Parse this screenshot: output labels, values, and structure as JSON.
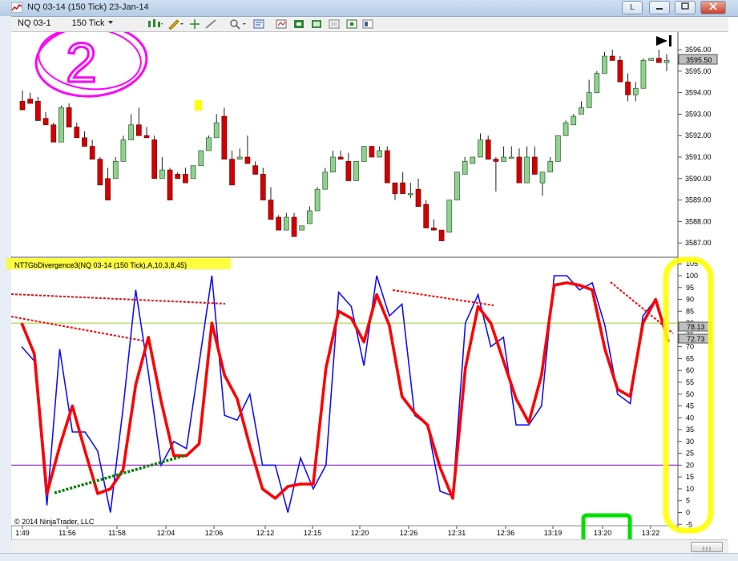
{
  "window": {
    "title": "NQ 03-14 (150 Tick)  23-Jan-14",
    "buttons": [
      "L",
      "",
      ""
    ]
  },
  "toolbar": {
    "instrument_label": "NQ 03-1",
    "period_label": "150 Tick"
  },
  "chart": {
    "indicator_label": "NT7GbDivergence3(NQ 03-14 (150 Tick),A,10,3,8,45)",
    "copyright": "© 2014 NinjaTrader, LLC",
    "price_axis": [
      "3596.00",
      "3595.00",
      "3594.00",
      "3593.00",
      "3592.00",
      "3591.00",
      "3590.00",
      "3589.00",
      "3588.00",
      "3587.00"
    ],
    "price_marker": "3595.50",
    "osc_axis": [
      "105",
      "100",
      "95",
      "90",
      "85",
      "80",
      "75",
      "70",
      "65",
      "60",
      "55",
      "50",
      "45",
      "40",
      "35",
      "30",
      "25",
      "20",
      "15",
      "10",
      "5",
      "0",
      "-5"
    ],
    "osc_markers": [
      "78.13",
      "72.73"
    ],
    "time_axis": [
      "1:49",
      "11:56",
      "11:58",
      "12:04",
      "12:06",
      "12:12",
      "12:15",
      "12:20",
      "12:26",
      "12:31",
      "12:36",
      "13:19",
      "13:20",
      "13:22"
    ],
    "annotation_number": "2",
    "colors": {
      "up_candle": "#8fd18f",
      "down_candle": "#d40000",
      "fast_line": "#1010ff",
      "slow_line": "#ff0000",
      "level_upper": "#9acd32",
      "level_lower": "#9932cc",
      "highlight_yellow": "#ffff00",
      "highlight_green": "#00e000",
      "annotation_magenta": "#ff00ff"
    },
    "levels": {
      "upper": 80,
      "lower": 20
    },
    "candles": [
      [
        3593.6,
        3594.1,
        3593.9,
        3593.2
      ],
      [
        3593.7,
        3594.0,
        3593.7,
        3593.5
      ],
      [
        3593.6,
        3593.8,
        3593.6,
        3592.7
      ],
      [
        3592.8,
        3593.1,
        3592.8,
        3592.5
      ],
      [
        3592.5,
        3592.6,
        3592.5,
        3591.7
      ],
      [
        3591.7,
        3593.4,
        3591.8,
        3593.3
      ],
      [
        3593.3,
        3593.5,
        3593.3,
        3592.4
      ],
      [
        3592.4,
        3592.6,
        3592.4,
        3591.9
      ],
      [
        3591.9,
        3592.2,
        3591.8,
        3591.5
      ],
      [
        3591.5,
        3591.8,
        3591.5,
        3590.9
      ],
      [
        3590.9,
        3591.0,
        3590.9,
        3589.7
      ],
      [
        3590.0,
        3590.5,
        3590.0,
        3589.0
      ],
      [
        3590.0,
        3591.0,
        3590.0,
        3590.8
      ],
      [
        3590.8,
        3592.0,
        3590.8,
        3591.8
      ],
      [
        3591.8,
        3593.0,
        3591.8,
        3592.5
      ],
      [
        3592.5,
        3593.3,
        3592.4,
        3592.0
      ],
      [
        3592.0,
        3592.4,
        3592.0,
        3591.9
      ],
      [
        3591.8,
        3592.0,
        3591.8,
        3590.0
      ],
      [
        3590.0,
        3591.0,
        3590.0,
        3590.4
      ],
      [
        3590.4,
        3590.5,
        3590.2,
        3589.0
      ],
      [
        3590.2,
        3590.3,
        3590.2,
        3590.0
      ],
      [
        3590.2,
        3590.5,
        3590.2,
        3589.8
      ],
      [
        3590.0,
        3590.6,
        3590.0,
        3590.6
      ],
      [
        3590.6,
        3591.3,
        3590.6,
        3591.3
      ],
      [
        3591.3,
        3592.0,
        3591.3,
        3591.9
      ],
      [
        3591.9,
        3593.0,
        3591.9,
        3592.6
      ],
      [
        3592.9,
        3593.3,
        3592.9,
        3590.9
      ],
      [
        3590.9,
        3591.3,
        3590.9,
        3589.7
      ],
      [
        3590.9,
        3591.4,
        3590.9,
        3591.0
      ],
      [
        3591.0,
        3592.0,
        3591.0,
        3590.7
      ],
      [
        3590.6,
        3590.8,
        3590.6,
        3590.2
      ],
      [
        3590.2,
        3590.5,
        3590.2,
        3589.0
      ],
      [
        3589.0,
        3589.6,
        3589.0,
        3588.1
      ],
      [
        3588.2,
        3588.3,
        3588.2,
        3587.6
      ],
      [
        3587.6,
        3588.4,
        3587.6,
        3588.2
      ],
      [
        3588.2,
        3588.4,
        3588.0,
        3587.3
      ],
      [
        3587.6,
        3587.8,
        3587.6,
        3587.8
      ],
      [
        3587.9,
        3588.7,
        3587.9,
        3588.5
      ],
      [
        3588.5,
        3589.6,
        3588.5,
        3589.5
      ],
      [
        3589.5,
        3590.5,
        3589.5,
        3590.3
      ],
      [
        3590.3,
        3591.3,
        3590.3,
        3591.0
      ],
      [
        3591.0,
        3591.3,
        3591.0,
        3590.9
      ],
      [
        3590.8,
        3591.2,
        3590.8,
        3589.9
      ],
      [
        3589.9,
        3590.8,
        3589.9,
        3590.8
      ],
      [
        3590.8,
        3591.5,
        3590.8,
        3591.5
      ],
      [
        3591.5,
        3591.5,
        3591.5,
        3591.0
      ],
      [
        3591.0,
        3591.5,
        3591.0,
        3591.3
      ],
      [
        3591.3,
        3591.5,
        3591.2,
        3589.8
      ],
      [
        3589.8,
        3589.8,
        3589.0,
        3589.3
      ],
      [
        3589.8,
        3590.3,
        3589.8,
        3589.3
      ],
      [
        3589.3,
        3589.8,
        3589.1,
        3589.3
      ],
      [
        3589.5,
        3590.0,
        3589.5,
        3588.7
      ],
      [
        3588.8,
        3589.0,
        3588.8,
        3587.7
      ],
      [
        3587.7,
        3588.1,
        3587.6,
        3587.6
      ],
      [
        3587.6,
        3587.6,
        3587.5,
        3587.1
      ],
      [
        3587.5,
        3589.0,
        3587.5,
        3589.0
      ],
      [
        3589.0,
        3590.3,
        3589.0,
        3590.3
      ],
      [
        3590.2,
        3591.0,
        3590.2,
        3590.8
      ],
      [
        3590.7,
        3591.0,
        3590.7,
        3591.0
      ],
      [
        3591.0,
        3592.1,
        3591.0,
        3591.8
      ],
      [
        3591.8,
        3592.0,
        3591.6,
        3590.9
      ],
      [
        3590.9,
        3591.0,
        3589.4,
        3590.8
      ],
      [
        3590.8,
        3591.5,
        3590.8,
        3591.0
      ],
      [
        3591.0,
        3591.5,
        3591.0,
        3591.0
      ],
      [
        3591.0,
        3591.4,
        3590.5,
        3589.8
      ],
      [
        3589.8,
        3591.5,
        3589.8,
        3591.0
      ],
      [
        3591.0,
        3591.5,
        3591.0,
        3590.2
      ],
      [
        3589.8,
        3590.3,
        3589.2,
        3590.3
      ],
      [
        3590.3,
        3591.0,
        3590.3,
        3590.8
      ],
      [
        3590.8,
        3592.0,
        3590.8,
        3592.0
      ],
      [
        3592.0,
        3592.7,
        3592.0,
        3592.6
      ],
      [
        3592.5,
        3593.0,
        3592.5,
        3592.9
      ],
      [
        3593.0,
        3593.6,
        3593.0,
        3593.3
      ],
      [
        3593.3,
        3594.6,
        3593.3,
        3594.0
      ],
      [
        3594.0,
        3595.0,
        3594.0,
        3594.9
      ],
      [
        3594.9,
        3595.9,
        3594.9,
        3595.7
      ],
      [
        3595.7,
        3596.0,
        3595.7,
        3595.5
      ],
      [
        3595.5,
        3595.7,
        3595.5,
        3594.5
      ],
      [
        3594.5,
        3594.9,
        3593.6,
        3593.9
      ],
      [
        3593.9,
        3594.5,
        3593.6,
        3594.2
      ],
      [
        3594.2,
        3595.6,
        3594.2,
        3595.5
      ],
      [
        3595.5,
        3595.6,
        3595.5,
        3595.6
      ],
      [
        3595.6,
        3596.0,
        3595.6,
        3595.4
      ],
      [
        3595.4,
        3595.8,
        3595.0,
        3595.5
      ]
    ],
    "osc_fast": [
      70,
      64,
      3,
      69,
      34,
      34,
      26,
      0,
      44,
      94,
      59,
      20,
      30,
      27,
      63,
      100,
      41,
      39,
      50,
      20,
      20,
      0,
      23,
      10,
      20,
      93,
      87,
      62,
      100,
      83,
      88,
      41,
      37,
      9,
      7,
      80,
      92,
      70,
      74,
      37,
      37,
      45,
      100,
      100,
      94,
      97,
      79,
      50,
      46,
      83,
      90,
      72
    ],
    "osc_slow": [
      80,
      67,
      8,
      28,
      45,
      26,
      8,
      10,
      18,
      54,
      74,
      47,
      24,
      24,
      29,
      80,
      58,
      48,
      28,
      10,
      6,
      11,
      12,
      12,
      61,
      85,
      82,
      72,
      92,
      79,
      49,
      42,
      37,
      19,
      6,
      61,
      87,
      80,
      64,
      48,
      38,
      58,
      96,
      97,
      96,
      94,
      69,
      52,
      49,
      80,
      90,
      72
    ]
  }
}
